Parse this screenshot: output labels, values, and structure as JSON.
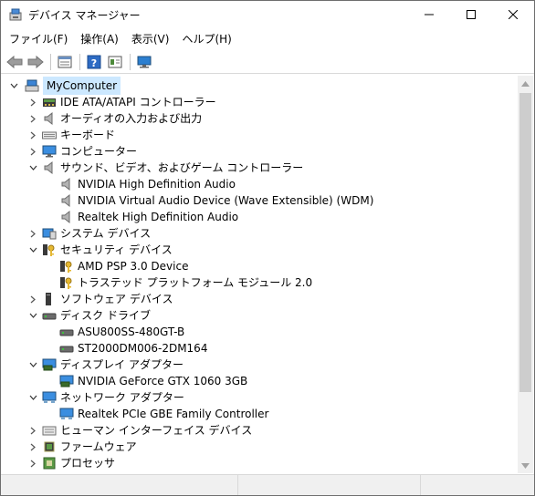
{
  "window": {
    "title": "デバイス マネージャー"
  },
  "menu": [
    "ファイル(F)",
    "操作(A)",
    "表示(V)",
    "ヘルプ(H)"
  ],
  "toolbar": {
    "icons": [
      "back-icon",
      "forward-icon",
      "properties-icon",
      "help-icon",
      "details-icon",
      "monitor-icon"
    ]
  },
  "tree": {
    "root": "MyComputer",
    "nodes": [
      {
        "label": "IDE ATA/ATAPI コントローラー",
        "expanded": false
      },
      {
        "label": "オーディオの入力および出力",
        "expanded": false
      },
      {
        "label": "キーボード",
        "expanded": false
      },
      {
        "label": "コンピューター",
        "expanded": false
      },
      {
        "label": "サウンド、ビデオ、およびゲーム コントローラー",
        "expanded": true
      },
      {
        "label": "NVIDIA High Definition Audio"
      },
      {
        "label": "NVIDIA Virtual Audio Device (Wave Extensible) (WDM)"
      },
      {
        "label": "Realtek High Definition Audio"
      },
      {
        "label": "システム デバイス",
        "expanded": false
      },
      {
        "label": "セキュリティ デバイス",
        "expanded": true
      },
      {
        "label": "AMD PSP 3.0 Device"
      },
      {
        "label": "トラステッド プラットフォーム モジュール 2.0"
      },
      {
        "label": "ソフトウェア デバイス",
        "expanded": false
      },
      {
        "label": "ディスク ドライブ",
        "expanded": true
      },
      {
        "label": "ASU800SS-480GT-B"
      },
      {
        "label": "ST2000DM006-2DM164"
      },
      {
        "label": "ディスプレイ アダプター",
        "expanded": true
      },
      {
        "label": "NVIDIA GeForce GTX 1060 3GB"
      },
      {
        "label": "ネットワーク アダプター",
        "expanded": true
      },
      {
        "label": "Realtek PCIe GBE Family Controller"
      },
      {
        "label": "ヒューマン インターフェイス デバイス",
        "expanded": false
      },
      {
        "label": "ファームウェア",
        "expanded": false
      },
      {
        "label": "プロセッサ",
        "expanded": false
      }
    ]
  }
}
